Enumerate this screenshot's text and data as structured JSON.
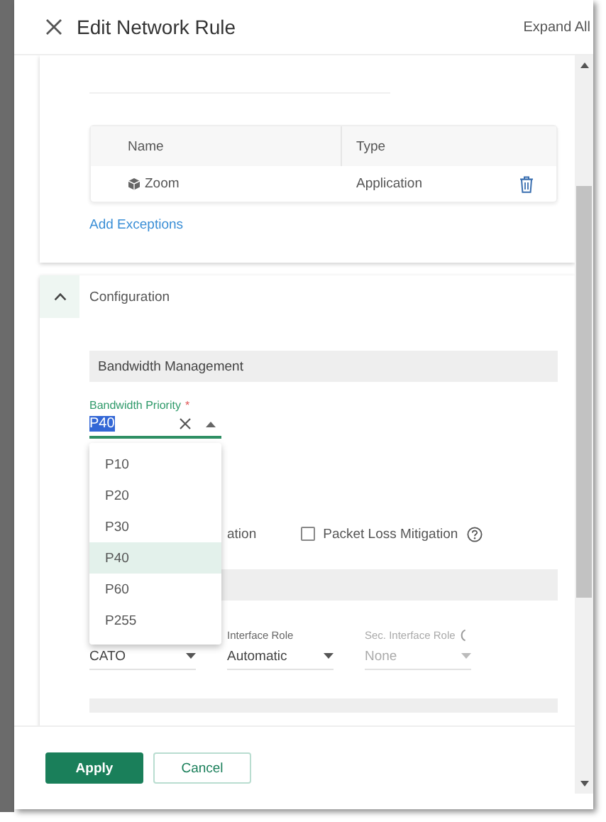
{
  "window": {
    "title": "Edit Network Rule",
    "expand_all": "Expand All"
  },
  "exceptions": {
    "columns": [
      "Name",
      "Type"
    ],
    "rows": [
      {
        "name": "Zoom",
        "type": "Application"
      }
    ],
    "add_link": "Add Exceptions"
  },
  "configuration": {
    "title": "Configuration",
    "expanded": true,
    "section_title": "Bandwidth Management",
    "priority": {
      "label": "Bandwidth Priority",
      "required_mark": "*",
      "value": "P40",
      "open": true,
      "options": [
        {
          "label": "P10",
          "selected": false
        },
        {
          "label": "P20",
          "selected": false
        },
        {
          "label": "P30",
          "selected": false
        },
        {
          "label": "P40",
          "selected": true
        },
        {
          "label": "P60",
          "selected": false
        },
        {
          "label": "P255",
          "selected": false
        }
      ]
    },
    "checkboxes": [
      {
        "label": "ation"
      },
      {
        "label": "Packet Loss Mitigation",
        "checked": false,
        "help": true
      }
    ],
    "fields": [
      {
        "value": "CATO",
        "disabled": false
      },
      {
        "label": "Interface Role",
        "value": "Automatic",
        "disabled": false
      },
      {
        "label": "Sec. Interface Role",
        "value": "None",
        "disabled": true
      }
    ]
  },
  "buttons": [
    {
      "label": "Apply",
      "kind": "primary"
    },
    {
      "label": "Cancel",
      "kind": "secondary"
    }
  ]
}
